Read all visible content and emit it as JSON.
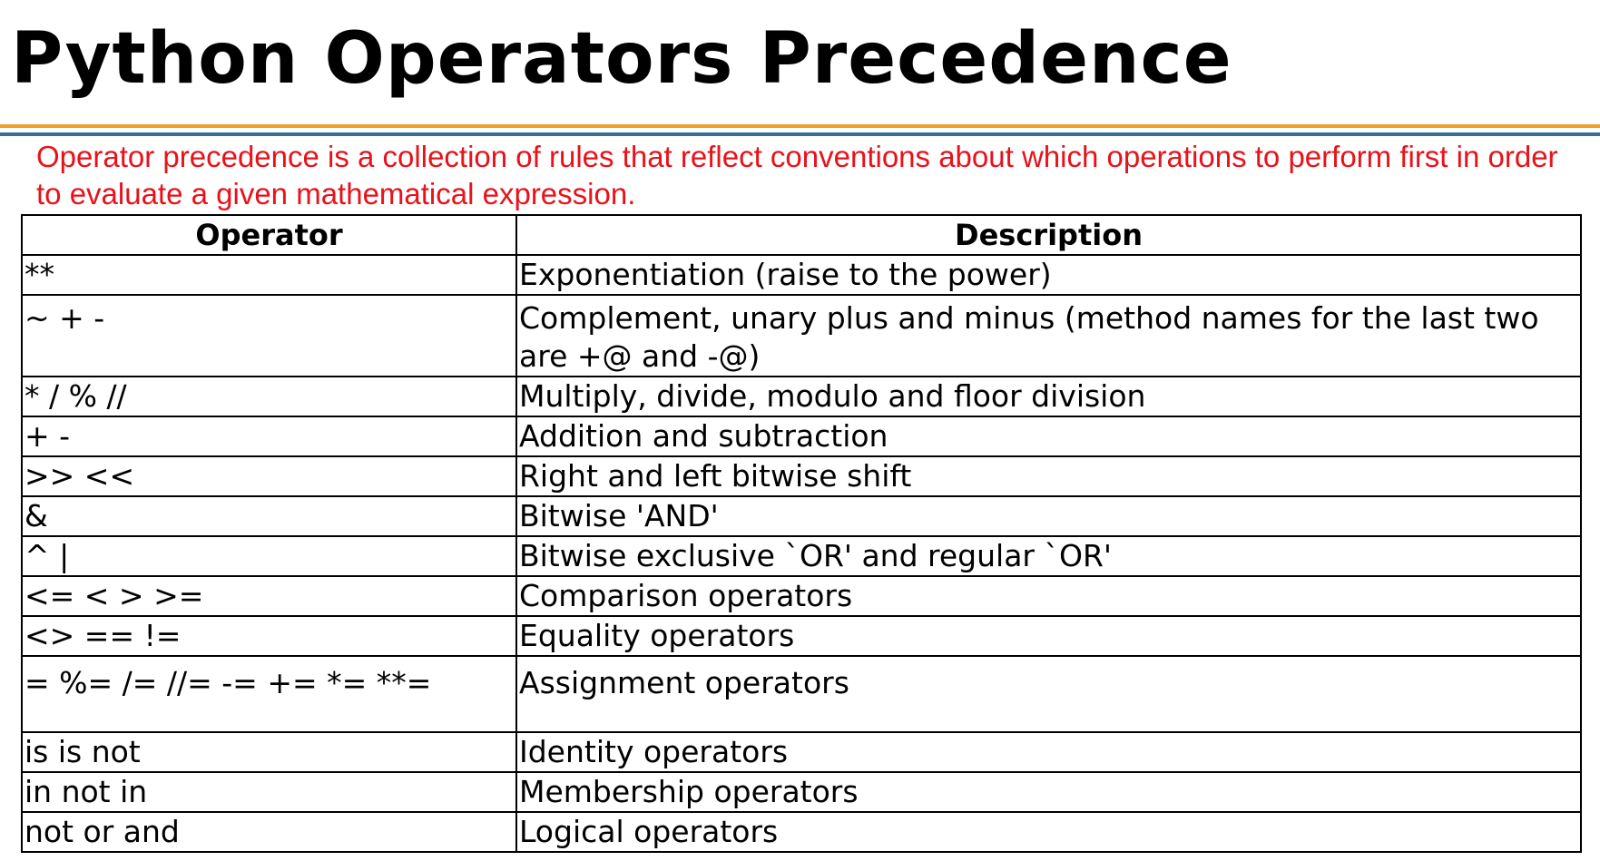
{
  "slide": {
    "title": "Python Operators Precedence",
    "intro": "Operator precedence is a collection of rules that reflect conventions about which operations to perform first in order to evaluate a given mathematical expression."
  },
  "colors": {
    "intro_text": "#e8121a",
    "rule_orange": "#f0a02a",
    "rule_blue": "#3b6d99"
  },
  "table": {
    "headers": [
      "Operator",
      "Description"
    ],
    "rows": [
      {
        "operator": "**",
        "description": "Exponentiation (raise to the power)"
      },
      {
        "operator": "~ + -",
        "description": "Complement, unary plus and minus (method names for the last two are +@ and -@)"
      },
      {
        "operator": "* / % //",
        "description": "Multiply, divide, modulo and floor division"
      },
      {
        "operator": "+ -",
        "description": "Addition and subtraction"
      },
      {
        "operator": ">> <<",
        "description": "Right and left bitwise shift"
      },
      {
        "operator": "&",
        "description": "Bitwise 'AND'"
      },
      {
        "operator": "^ |",
        "description": "Bitwise exclusive `OR' and regular `OR'"
      },
      {
        "operator": "<= < > >=",
        "description": "Comparison operators"
      },
      {
        "operator": "<> == !=",
        "description": "Equality operators"
      },
      {
        "operator": "= %= /= //= -= += *= **=",
        "description": "Assignment operators"
      },
      {
        "operator": "is is not",
        "description": "Identity operators"
      },
      {
        "operator": "in not in",
        "description": "Membership operators"
      },
      {
        "operator": "not or and",
        "description": "Logical operators"
      }
    ]
  }
}
